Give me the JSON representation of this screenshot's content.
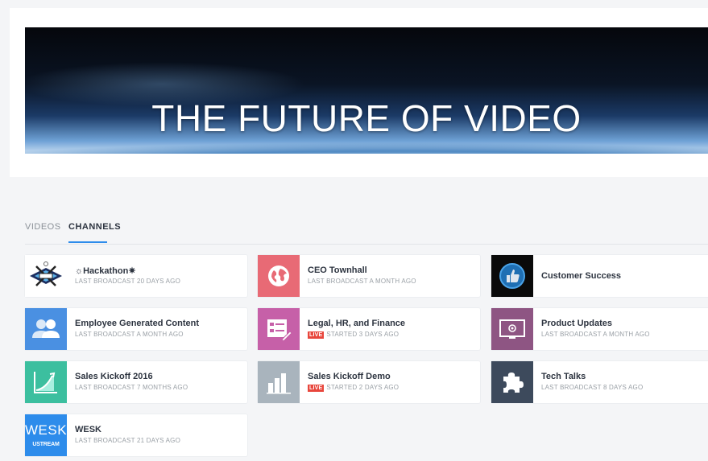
{
  "hero": {
    "title": "THE FUTURE OF VIDEO"
  },
  "tabs": [
    {
      "label": "VIDEOS",
      "active": false
    },
    {
      "label": "CHANNELS",
      "active": true
    }
  ],
  "channels": [
    {
      "title": "☼Hackathon✷",
      "subtitle": "LAST BROADCAST 20 DAYS AGO",
      "live": false,
      "thumb_bg": "#ffffff",
      "icon": "hackathon-logo-icon"
    },
    {
      "title": "CEO Townhall",
      "subtitle": "LAST BROADCAST A MONTH AGO",
      "live": false,
      "thumb_bg": "#e86a75",
      "icon": "globe-icon"
    },
    {
      "title": "Customer Success",
      "subtitle": "",
      "live": false,
      "thumb_bg": "#0a0a0a",
      "icon": "thumbs-up-icon"
    },
    {
      "title": "Employee Generated Content",
      "subtitle": "LAST BROADCAST A MONTH AGO",
      "live": false,
      "thumb_bg": "#4a90e2",
      "icon": "users-icon"
    },
    {
      "title": "Legal, HR, and Finance",
      "subtitle": "STARTED 3 DAYS AGO",
      "live": true,
      "live_label": "LIVE",
      "thumb_bg": "#c660a8",
      "icon": "form-edit-icon"
    },
    {
      "title": "Product Updates",
      "subtitle": "LAST BROADCAST A MONTH AGO",
      "live": false,
      "thumb_bg": "#8e5583",
      "icon": "monitor-icon"
    },
    {
      "title": "Sales Kickoff 2016",
      "subtitle": "LAST BROADCAST 7 MONTHS AGO",
      "live": false,
      "thumb_bg": "#3cbf9f",
      "icon": "growth-chart-icon"
    },
    {
      "title": "Sales Kickoff Demo",
      "subtitle": "STARTED 2 DAYS AGO",
      "live": true,
      "live_label": "LIVE",
      "thumb_bg": "#a9b4bd",
      "icon": "bar-chart-icon"
    },
    {
      "title": "Tech Talks",
      "subtitle": "LAST BROADCAST 8 DAYS AGO",
      "live": false,
      "thumb_bg": "#3d4a5c",
      "icon": "puzzle-icon"
    },
    {
      "title": "WESK",
      "subtitle": "LAST BROADCAST 21 DAYS AGO",
      "live": false,
      "thumb_bg": "#2d8ceb",
      "icon": "wesk-ustream-logo-icon",
      "thumb_text": "WESK",
      "thumb_subtext": "USTREAM"
    }
  ]
}
